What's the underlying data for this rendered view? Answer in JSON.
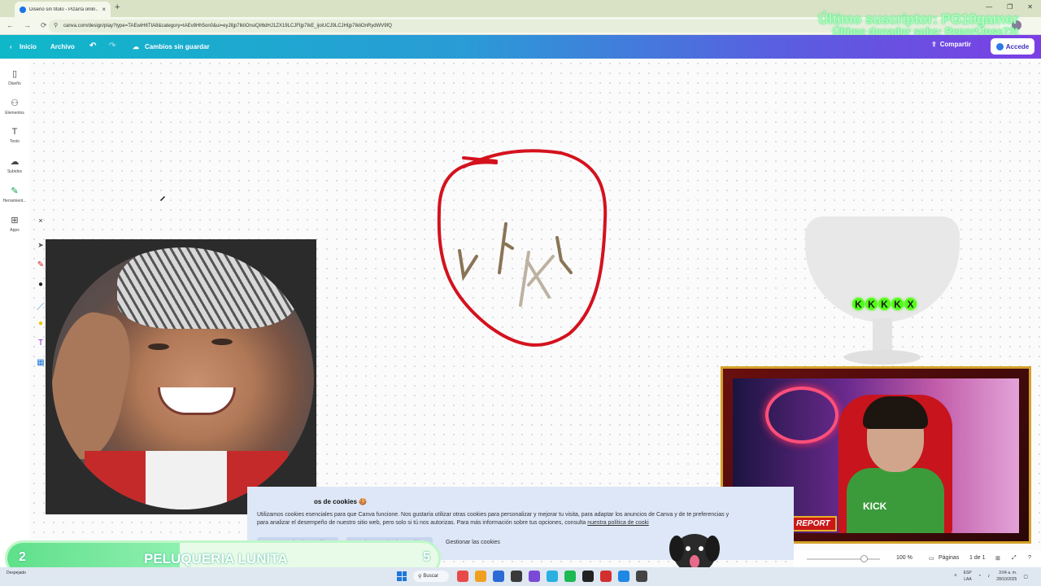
{
  "browser": {
    "tab_title": "Diseño sin título - Pizarra onlin...",
    "tab_close": "×",
    "new_tab": "+",
    "url": "canva.com/design/play?type=TAEwiH6TtA8&category=tAEv8Hh5on0&ui=eyJlIjp7IkliOnsiQiI6dHJ1ZX19LCJFIjp7IkE_ijoiUCJ9LCJHIjp7IkliOnRydWV9fQ",
    "win_controls": [
      "—",
      "❐",
      "✕"
    ]
  },
  "overlay": {
    "last_subscriber": "Último suscriptor: PG10gamer",
    "last_donor": "Último donador subs: ReportJose72t"
  },
  "canva_header": {
    "home": "Inicio",
    "file": "Archivo",
    "undo": "↶",
    "redo": "↷",
    "status": "Cambios sin guardar",
    "share": "Compartir",
    "login": "Accede"
  },
  "sidebar": {
    "items": [
      {
        "label": "Diseño",
        "icon": "layout-icon",
        "glyph": "▯"
      },
      {
        "label": "Elementos",
        "icon": "elements-icon",
        "glyph": "⚇"
      },
      {
        "label": "Texto",
        "icon": "text-icon",
        "glyph": "T"
      },
      {
        "label": "Subidos",
        "icon": "upload-icon",
        "glyph": "☁"
      },
      {
        "label": "Herramient...",
        "icon": "draw-tools-icon",
        "glyph": "✎"
      },
      {
        "label": "Apps",
        "icon": "apps-icon",
        "glyph": "⊞"
      }
    ]
  },
  "palette": {
    "close": "×",
    "tools": [
      "➤",
      "✎",
      "●",
      "／",
      "●",
      "T",
      "▦"
    ]
  },
  "kick_chips": [
    "K",
    "K",
    "K",
    "K",
    "X"
  ],
  "streamer_cam": {
    "name_tag": "ALEJANDRO REPORT",
    "shirt_text": "KICK"
  },
  "cookies": {
    "title": "os de cookies 🍪",
    "body": "Utilizamos cookies esenciales para que Canva funcione. Nos gustaría utilizar otras cookies para personalizar y mejorar tu visita, para adaptar los anuncios de Canva y de te preferencias y para analizar el desempeño de nuestro sitio web, pero solo si tú nos autorizas. Para más información sobre tus opciones, consulta",
    "link": "nuestra política de cooki",
    "accept": "Aceptar todas las cookies",
    "reject": "Rechazar todas las cookies",
    "manage": "Gestionar las cookies"
  },
  "bottom_bar": {
    "zoom": "100 %",
    "pages": "Páginas",
    "page_count": "1 de 1"
  },
  "sub_goal": {
    "current": "2",
    "title": "PELUQUERIA LUNITA",
    "target": "5",
    "progress": 0.4
  },
  "taskbar": {
    "weather": "Despejado",
    "search": "Buscar",
    "lang": "ESP",
    "lang2": "LAA",
    "time": "3:04 a. m.",
    "date": "28/10/2025",
    "app_colors": [
      "#e84a4a",
      "#f0a020",
      "#2a6bd6",
      "#3a3a3a",
      "#7a4ad6",
      "#2ab0e0",
      "#1db954",
      "#222222",
      "#d23030",
      "#1e88e5",
      "#444444"
    ]
  }
}
